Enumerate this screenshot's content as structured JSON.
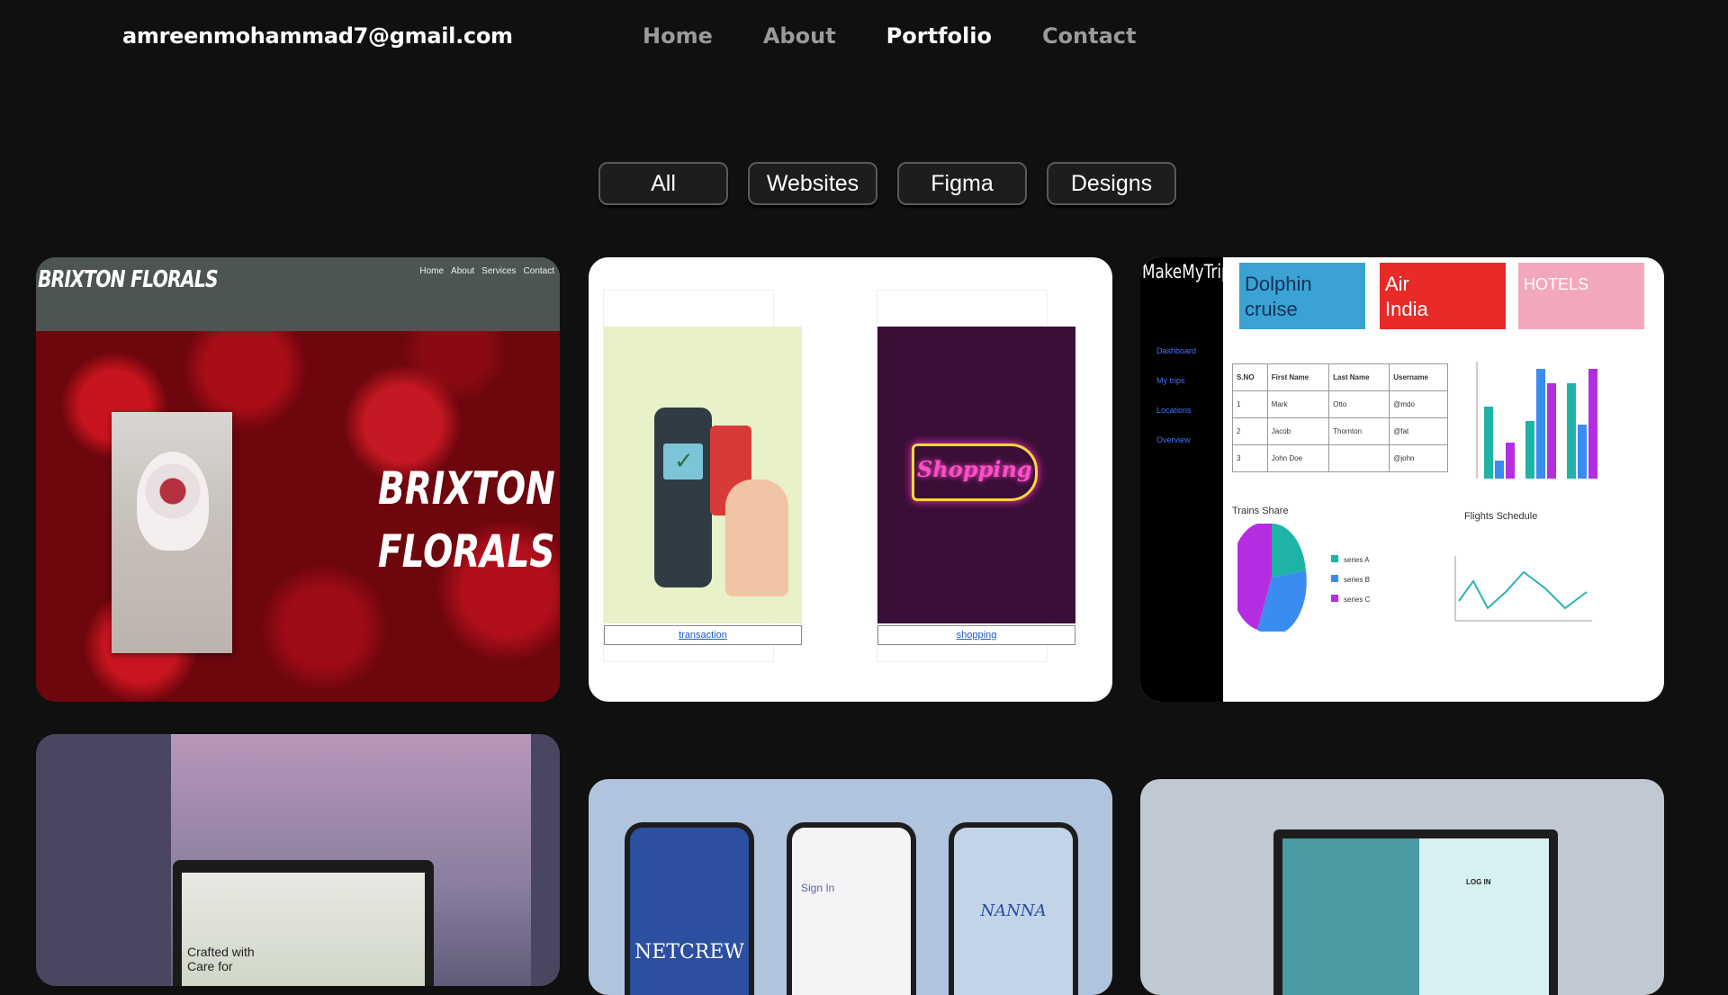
{
  "header": {
    "email": "amreenmohammad7@gmail.com",
    "nav": [
      {
        "label": "Home",
        "active": false
      },
      {
        "label": "About",
        "active": false
      },
      {
        "label": "Portfolio",
        "active": true
      },
      {
        "label": "Contact",
        "active": false
      }
    ]
  },
  "filters": [
    "All",
    "Websites",
    "Figma",
    "Designs"
  ],
  "cards": {
    "brixton": {
      "logo": "BRIXTON FLORALS",
      "menu": [
        "Home",
        "About",
        "Services",
        "Contact"
      ],
      "hero_title_line1": "BRIXTON",
      "hero_title_line2": "FLORALS"
    },
    "gallery": {
      "item1_link": "transaction",
      "item2_link": "shopping",
      "sign_text": "Shopping"
    },
    "makemytrip": {
      "logo": "MakeMyTrip",
      "nav": [
        "Dashboard",
        "My trips",
        "Locations",
        "Overview"
      ],
      "tiles": [
        "Dolphin cruise",
        "Air India",
        "HOTELS"
      ],
      "table_headers": [
        "S.NO",
        "First Name",
        "Last Name",
        "Username"
      ],
      "table_rows": [
        [
          "1",
          "Mark",
          "Otto",
          "@mdo"
        ],
        [
          "2",
          "Jacob",
          "Thornton",
          "@fat"
        ],
        [
          "3",
          "John Doe",
          "",
          "@john"
        ]
      ],
      "trains_title": "Trains Share",
      "flights_title": "Flights Schedule",
      "legend": [
        "series A",
        "series B",
        "series C"
      ]
    },
    "crafted": {
      "text": "Crafted with Care for"
    },
    "phones": {
      "phone1": "NETCREW",
      "phone2": "Sign In",
      "phone3": "NANNA"
    },
    "login": {
      "title": "LOG IN"
    }
  },
  "colors": {
    "background": "#101010",
    "nav_inactive": "#9a9a9a",
    "nav_active": "#ffffff",
    "filter_border": "#5a5a5a"
  }
}
